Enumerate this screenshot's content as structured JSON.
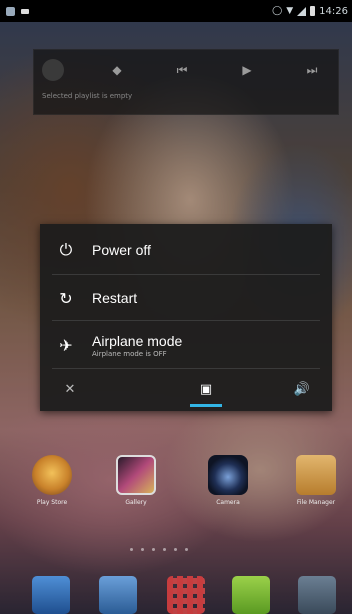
{
  "status_bar": {
    "time": "14:26"
  },
  "music_widget": {
    "status_text": "Selected playlist is empty",
    "buttons": {
      "album": "album-art-icon",
      "thumb": "◆",
      "prev": "⏮",
      "play": "▶",
      "next": "⏭"
    }
  },
  "power_menu": {
    "items": [
      {
        "label": "Power off",
        "icon": "⏻"
      },
      {
        "label": "Restart",
        "icon": "↻"
      },
      {
        "label": "Airplane mode",
        "sublabel": "Airplane mode is OFF",
        "icon": "✈"
      }
    ],
    "sound_modes": [
      {
        "name": "silent",
        "icon": "✕"
      },
      {
        "name": "vibrate",
        "icon": "▣",
        "selected": true
      },
      {
        "name": "sound-on",
        "icon": "🔊"
      }
    ]
  },
  "home_apps": [
    {
      "name": "Play Store"
    },
    {
      "name": "Gallery"
    },
    {
      "name": "Camera"
    },
    {
      "name": "File Manager"
    }
  ],
  "colors": {
    "accent": "#33b5e5",
    "menu_bg": "#1c1c1c"
  }
}
